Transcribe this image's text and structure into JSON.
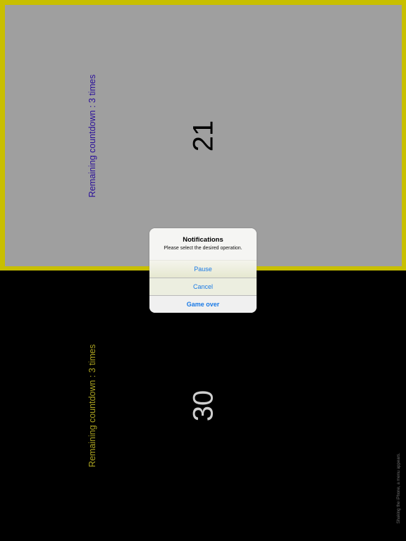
{
  "top_player": {
    "countdown_text": "Remaining countdown : 3 times",
    "counter": "21"
  },
  "bottom_player": {
    "countdown_text": "Remaining countdown : 3 times",
    "counter": "30"
  },
  "hint_text": "Shaking the iPhone, a menu appears.",
  "dialog": {
    "title": "Notifications",
    "message": "Please select the desired operation.",
    "buttons": [
      {
        "label": "Pause"
      },
      {
        "label": "Cancel"
      },
      {
        "label": "Game over"
      }
    ]
  },
  "colors": {
    "frame": "#c8bf00",
    "top_background": "#9f9f9f",
    "bottom_background": "#000000",
    "accent": "#1a7ae6"
  }
}
